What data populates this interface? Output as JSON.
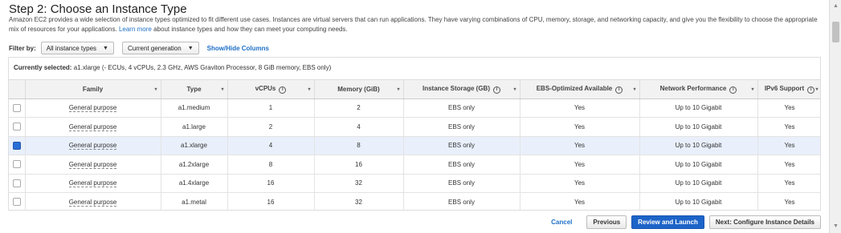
{
  "page": {
    "title": "Step 2: Choose an Instance Type",
    "description_main": "Amazon EC2 provides a wide selection of instance types optimized to fit different use cases. Instances are virtual servers that can run applications. They have varying combinations of CPU, memory, storage, and networking capacity, and give you the flexibility to choose the appropriate mix of resources for your applications. ",
    "learn_more": "Learn more",
    "description_tail": " about instance types and how they can meet your computing needs."
  },
  "filter": {
    "label": "Filter by:",
    "type_select": "All instance types",
    "generation_select": "Current generation",
    "show_hide": "Show/Hide Columns"
  },
  "selected": {
    "label": "Currently selected:",
    "value": "a1.xlarge (- ECUs, 4 vCPUs, 2.3 GHz, AWS Graviton Processor, 8 GiB memory, EBS only)"
  },
  "table": {
    "headers": {
      "family": "Family",
      "type": "Type",
      "vcpus": "vCPUs",
      "memory": "Memory (GiB)",
      "storage": "Instance Storage (GB)",
      "ebs": "EBS-Optimized Available",
      "network": "Network Performance",
      "ipv6": "IPv6 Support"
    },
    "rows": [
      {
        "family": "General purpose",
        "type": "a1.medium",
        "vcpus": "1",
        "memory": "2",
        "storage": "EBS only",
        "ebs": "Yes",
        "network": "Up to 10 Gigabit",
        "ipv6": "Yes"
      },
      {
        "family": "General purpose",
        "type": "a1.large",
        "vcpus": "2",
        "memory": "4",
        "storage": "EBS only",
        "ebs": "Yes",
        "network": "Up to 10 Gigabit",
        "ipv6": "Yes"
      },
      {
        "family": "General purpose",
        "type": "a1.xlarge",
        "vcpus": "4",
        "memory": "8",
        "storage": "EBS only",
        "ebs": "Yes",
        "network": "Up to 10 Gigabit",
        "ipv6": "Yes"
      },
      {
        "family": "General purpose",
        "type": "a1.2xlarge",
        "vcpus": "8",
        "memory": "16",
        "storage": "EBS only",
        "ebs": "Yes",
        "network": "Up to 10 Gigabit",
        "ipv6": "Yes"
      },
      {
        "family": "General purpose",
        "type": "a1.4xlarge",
        "vcpus": "16",
        "memory": "32",
        "storage": "EBS only",
        "ebs": "Yes",
        "network": "Up to 10 Gigabit",
        "ipv6": "Yes"
      },
      {
        "family": "General purpose",
        "type": "a1.metal",
        "vcpus": "16",
        "memory": "32",
        "storage": "EBS only",
        "ebs": "Yes",
        "network": "Up to 10 Gigabit",
        "ipv6": "Yes"
      }
    ],
    "selected_index": 2
  },
  "footer": {
    "cancel": "Cancel",
    "previous": "Previous",
    "review_launch": "Review and Launch",
    "next": "Next: Configure Instance Details"
  },
  "icons": {
    "info": "info-icon",
    "sort": "sort-caret-icon",
    "dropdown": "chevron-down-icon"
  },
  "colors": {
    "accent": "#1d64c8",
    "link": "#1e6fc7",
    "selected_row": "#e9f0fb"
  }
}
